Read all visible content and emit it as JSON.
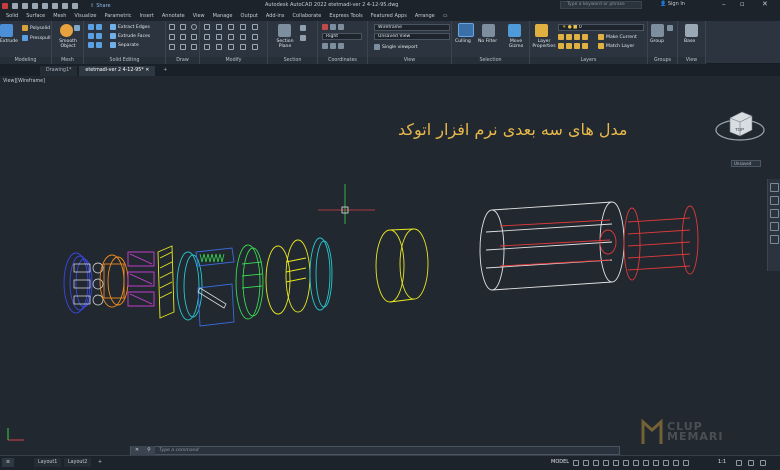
{
  "titlebar": {
    "share_label": "Share",
    "title": "Autodesk AutoCAD 2022   etetmadi-ver 2  4-12-95.dwg",
    "search_placeholder": "Type a keyword or phrase",
    "sign_in": "Sign In"
  },
  "tabs": [
    "Solid",
    "Surface",
    "Mesh",
    "Visualize",
    "Parametric",
    "Insert",
    "Annotate",
    "View",
    "Manage",
    "Output",
    "Add-ins",
    "Collaborate",
    "Express Tools",
    "Featured Apps",
    "Arrange"
  ],
  "ribbon": {
    "modeling": {
      "label": "Modeling",
      "extrude": "Extrude",
      "polysolid": "Polysolid",
      "presspull": "Presspull"
    },
    "mesh": {
      "label": "Mesh",
      "smooth": "Smooth Object"
    },
    "solid_editing": {
      "label": "Solid Editing",
      "extract_edges": "Extract Edges",
      "extrude_faces": "Extrude Faces",
      "separate": "Separate"
    },
    "draw": {
      "label": "Draw"
    },
    "modify": {
      "label": "Modify"
    },
    "section": {
      "label": "Section",
      "section_plane": "Section Plane"
    },
    "coordinates": {
      "label": "Coordinates",
      "ucs_value": "Right"
    },
    "view": {
      "label": "View",
      "visual_style": "Wireframe",
      "named_view": "Unsaved View",
      "viewport": "Single viewport"
    },
    "selection": {
      "label": "Selection",
      "culling": "Culling",
      "no_filter": "No Filter",
      "move_gizmo": "Move Gizmo"
    },
    "layers": {
      "label": "Layers",
      "layer_properties": "Layer Properties",
      "layer_value": "0",
      "make_current": "Make Current",
      "match_layer": "Match Layer"
    },
    "groups": {
      "label": "Groups",
      "group": "Group"
    },
    "view_panel": {
      "label": "View",
      "base": "Base"
    }
  },
  "doc_tabs": [
    "Drawing1*",
    "etetmadi-ver 2  4-12-95*"
  ],
  "viewport": {
    "label": "View][Wireframe]",
    "overlay_title": "مدل های سه بعدی نرم افزار اتوکد",
    "viewcube_face": "TOP",
    "unsaved_chip": "Unsaved"
  },
  "command": {
    "placeholder": "Type a command"
  },
  "statusbar": {
    "layouts": [
      "Layout1",
      "Layout2"
    ],
    "model": "MODEL",
    "scale": "1:1"
  },
  "watermark": {
    "line1": "CLUP",
    "line2": "MEMARI"
  },
  "colors": {
    "accent": "#e9b84a",
    "canvas": "#212830",
    "ribbon": "#2c353f"
  }
}
